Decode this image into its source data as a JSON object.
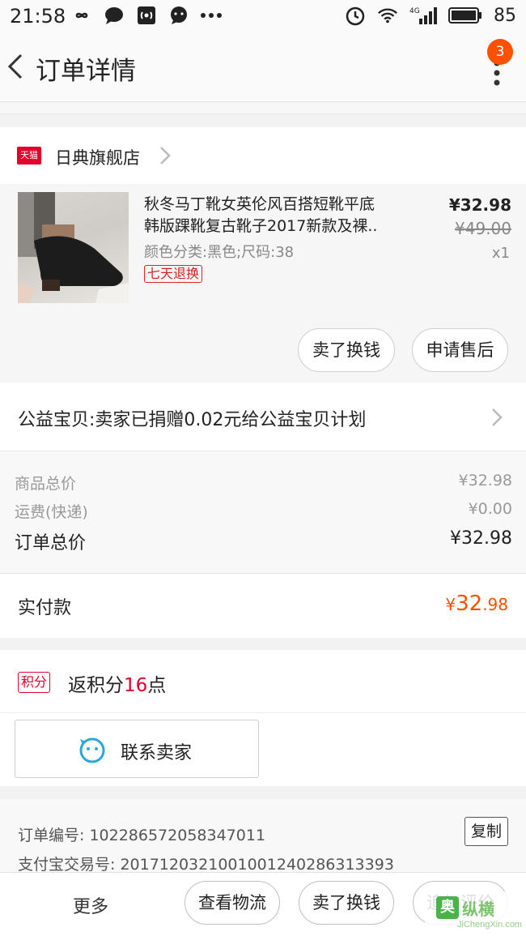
{
  "status_bar": {
    "time": "21:58",
    "battery": "85",
    "network": "4G"
  },
  "nav": {
    "title": "订单详情",
    "badge": "3"
  },
  "shop": {
    "badge": "天猫",
    "name": "日典旗舰店"
  },
  "product": {
    "title_line1": "秋冬马丁靴女英伦风百搭短靴平底",
    "title_line2": "韩版踝靴复古靴子2017新款及裸..",
    "spec": "颜色分类:黑色;尺码:38",
    "tag": "七天退换",
    "price": "¥32.98",
    "original_price": "¥49.00",
    "quantity": "x1",
    "btn_exchange": "卖了换钱",
    "btn_aftersale": "申请售后"
  },
  "charity": {
    "text": "公益宝贝:卖家已捐赠0.02元给公益宝贝计划"
  },
  "summary": {
    "goods_label": "商品总价",
    "goods_value": "¥32.98",
    "shipping_label": "运费(快递)",
    "shipping_value": "¥0.00",
    "order_total_label": "订单总价",
    "order_total_value": "¥32.98"
  },
  "paid": {
    "label": "实付款",
    "currency": "¥",
    "integer": "32",
    "decimal": ".98"
  },
  "points": {
    "tag": "积分",
    "prefix": "返积分",
    "number": "16",
    "suffix": "点"
  },
  "contact": {
    "label": "联系卖家"
  },
  "order_info": {
    "order_no": "订单编号: 1022865720583470​11",
    "alipay_no": "支付宝交易号: 2017120321001001240286313393",
    "copy_label": "复制"
  },
  "bottom_bar": {
    "more": "更多",
    "logistics": "查看物流",
    "exchange": "卖了换钱",
    "review": "追加评价"
  },
  "watermark": {
    "logo": "奥",
    "title": "纵横",
    "url": "JiChengXin.com"
  },
  "colors": {
    "accent": "#ff5000",
    "tmall_red": "#e4002b"
  }
}
